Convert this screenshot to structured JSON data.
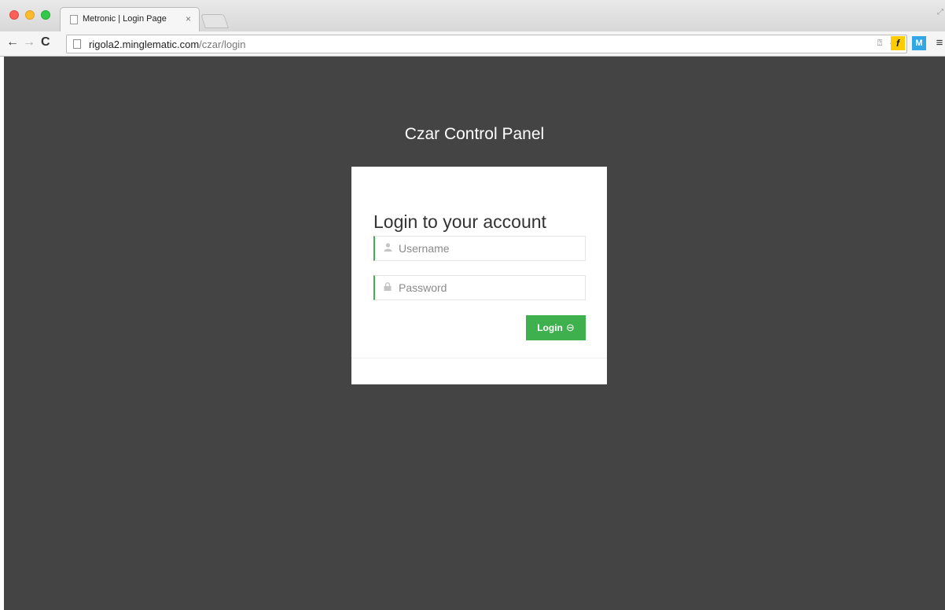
{
  "browser": {
    "tab_title": "Metronic | Login Page",
    "tab_close": "×",
    "url_host": "rigola2.minglematic.com",
    "url_path": "/czar/login",
    "ext_2": "f",
    "ext_3": "M"
  },
  "page": {
    "panel_title": "Czar Control Panel",
    "login_heading": "Login to your account",
    "username_placeholder": "Username",
    "password_placeholder": "Password",
    "login_button": "Login"
  },
  "colors": {
    "background": "#444444",
    "accent": "#3eb04d"
  }
}
